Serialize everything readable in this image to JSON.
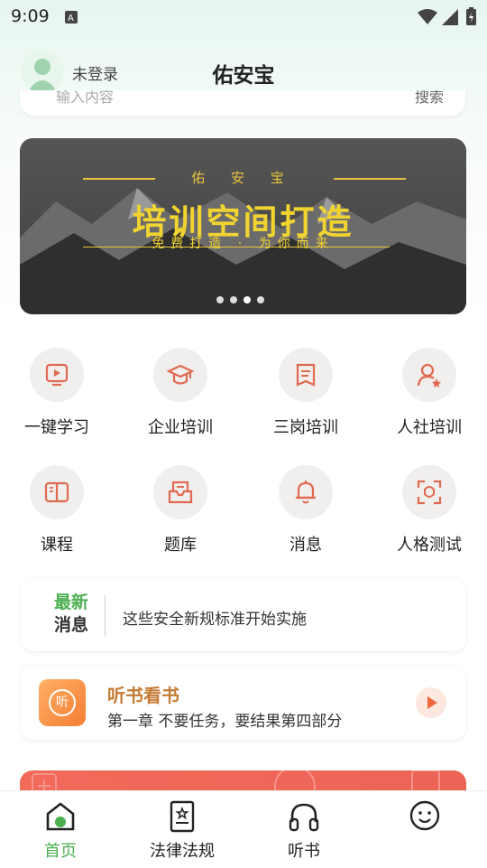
{
  "status_bar": {
    "time": "9:09"
  },
  "header": {
    "login_status": "未登录",
    "app_title": "佑安宝"
  },
  "search": {
    "placeholder": "输入内容",
    "button": "搜索"
  },
  "banner": {
    "subtitle": "佑 安 宝",
    "title": "培训空间打造",
    "slogan": "免费打造 · 为你而来",
    "dots_total": 4,
    "active_dot_index": 2
  },
  "grid": [
    {
      "label": "一键学习",
      "icon": "play-video-icon"
    },
    {
      "label": "企业培训",
      "icon": "graduation-cap-icon"
    },
    {
      "label": "三岗培训",
      "icon": "document-icon"
    },
    {
      "label": "人社培训",
      "icon": "user-star-icon"
    },
    {
      "label": "课程",
      "icon": "book-icon"
    },
    {
      "label": "题库",
      "icon": "inbox-icon"
    },
    {
      "label": "消息",
      "icon": "bell-icon"
    },
    {
      "label": "人格测试",
      "icon": "face-scan-icon"
    }
  ],
  "news": {
    "badge_line1": "最新",
    "badge_line2": "消息",
    "headline": "这些安全新规标准开始实施"
  },
  "audio": {
    "icon_text": "听",
    "title": "听书看书",
    "subtitle": "第一章 不要任务，要结果第四部分"
  },
  "tabs": [
    {
      "label": "首页",
      "icon": "home-icon",
      "active": true
    },
    {
      "label": "法律法规",
      "icon": "law-book-icon",
      "active": false
    },
    {
      "label": "听书",
      "icon": "headphones-icon",
      "active": false
    },
    {
      "label": "",
      "icon": "smiley-icon",
      "active": false
    }
  ],
  "colors": {
    "accent_green": "#4caf50",
    "icon_red": "#e06a50",
    "banner_yellow": "#f2d431",
    "audio_title": "#c57b34"
  }
}
